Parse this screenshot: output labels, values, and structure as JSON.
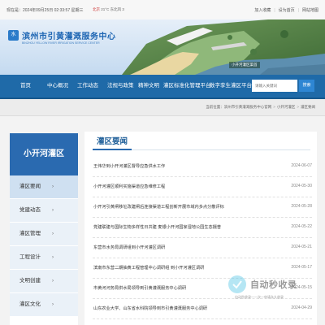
{
  "topbar": {
    "date": "现在是：2024年09月25日 02:33:57 星期三",
    "weather_loc": "北京",
    "weather": "21°C  东北风 3",
    "links": [
      "加入收藏",
      "设为首页",
      "网站地图"
    ]
  },
  "banner": {
    "logo_mark": "水",
    "site_name": "滨州市引黄灌溉服务中心",
    "site_sub": "BINZHOU YELLOW RIVER IRRIGATION SERVICE CENTER",
    "photo_label": "小开河灌区渠首"
  },
  "nav": {
    "items": [
      "首页",
      "中心概况",
      "工作动态",
      "法规与政策",
      "精神文明",
      "灌区标准化管理平台",
      "数字孪生灌区平台"
    ],
    "search_placeholder": "请输入关键词",
    "search_button": "搜索"
  },
  "breadcrumb": {
    "prefix": "当前位置：",
    "items": [
      "滨州市引黄灌溉服务中心官网",
      "小开河灌区",
      "灌区要闻"
    ],
    "separator": ">"
  },
  "sidebar": {
    "title": "小开河灌区",
    "items": [
      "灌区要闻",
      "党建动态",
      "灌区管理",
      "工程设计",
      "文明创建",
      "灌区文化"
    ],
    "active_index": 0,
    "chevron": "›"
  },
  "main": {
    "section_title": "灌区要闻",
    "news": [
      {
        "title": "王伟华到小开河灌区督导应急供水工作",
        "date": "2024-06-07"
      },
      {
        "title": "小开河灌区顺利实施渠道应急维修工程",
        "date": "2024-05-30"
      },
      {
        "title": "小开河引黄闸移址改建闸后连接渠道工程创新开展市域内多点分散评标",
        "date": "2024-05-28"
      },
      {
        "title": "党建联建与国际生物多样性日共建 麦银小开河国家湿地公园生态摄普",
        "date": "2024-05-22"
      },
      {
        "title": "东营市水务局调研组到小开河灌区调研",
        "date": "2024-05-21"
      },
      {
        "title": "滨南市东营二期抽黄工程管理中心调研组 到小开河灌区调研",
        "date": "2024-05-17"
      },
      {
        "title": "市黄河河务局供水局领导到引黄灌溉服务中心调研",
        "date": "2024-05-15"
      },
      {
        "title": "山东农业大学、山东省水科院领导到市引黄灌溉服务中心调研",
        "date": "2024-04-29"
      }
    ]
  },
  "watermark": {
    "text": "自动秒收录",
    "sub": "自动秒收录一一次一申请永久收录"
  },
  "colors": {
    "nav_bg": "#1f6aa8",
    "sidebar_head": "#2a6ab0",
    "title_blue": "#1f5f99",
    "search_btn": "#2e86d3"
  }
}
